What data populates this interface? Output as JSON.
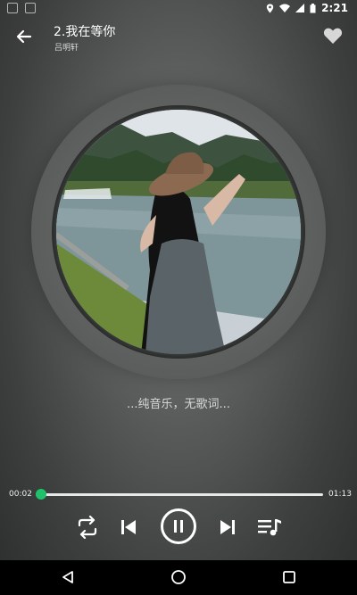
{
  "status_bar": {
    "time": "2:21"
  },
  "header": {
    "title": "2.我在等你",
    "artist": "吕明轩"
  },
  "lyrics": {
    "current_line": "...纯音乐，无歌词..."
  },
  "player": {
    "current_time": "00:02",
    "total_time": "01:13",
    "progress": 0.02,
    "state": "playing"
  },
  "icons": {
    "back": "arrow-left-icon",
    "favorite": "heart-icon",
    "repeat": "repeat-icon",
    "previous": "skip-previous-icon",
    "pause": "pause-icon",
    "next": "skip-next-icon",
    "playlist": "playlist-icon",
    "nav_back": "triangle-back-icon",
    "nav_home": "circle-home-icon",
    "nav_recent": "square-recent-icon"
  },
  "colors": {
    "accent": "#1fc16b",
    "navbar": "#000000"
  }
}
